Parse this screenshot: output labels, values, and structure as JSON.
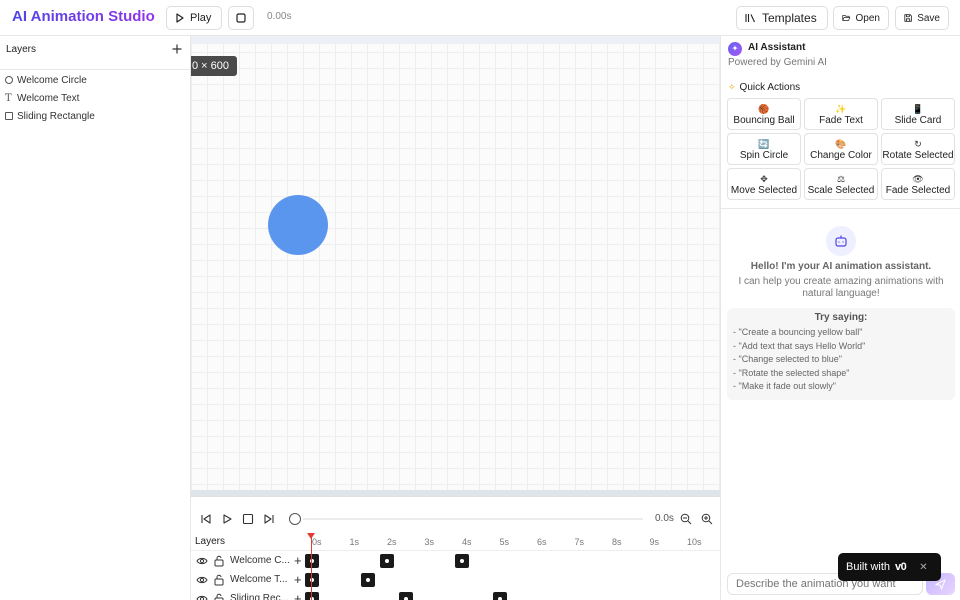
{
  "header": {
    "title": "AI Animation Studio",
    "play_label": "Play",
    "time": "0.00s",
    "templates_label": "Templates",
    "open_label": "Open",
    "save_label": "Save"
  },
  "layers_panel": {
    "title": "Layers",
    "items": [
      {
        "label": "Welcome Circle",
        "icon": "circle-icon"
      },
      {
        "label": "Welcome Text",
        "icon": "text-icon"
      },
      {
        "label": "Sliding Rectangle",
        "icon": "rectangle-icon"
      }
    ]
  },
  "canvas": {
    "size_label": "0 × 600",
    "shape_color": "#5b96ee"
  },
  "timeline": {
    "time": "0.0s",
    "layers_label": "Layers",
    "ticks": [
      "0s",
      "1s",
      "2s",
      "3s",
      "4s",
      "5s",
      "6s",
      "7s",
      "8s",
      "9s",
      "10s"
    ],
    "tracks": [
      {
        "name": "Welcome C...",
        "keyframes_s": [
          0,
          2,
          4
        ]
      },
      {
        "name": "Welcome T...",
        "keyframes_s": [
          0,
          1.5
        ]
      },
      {
        "name": "Sliding Rec...",
        "keyframes_s": [
          0,
          2.5,
          5
        ]
      }
    ]
  },
  "ai_panel": {
    "title": "AI Assistant",
    "subtitle": "Powered by Gemini AI",
    "quick_actions_title": "Quick Actions",
    "quick_actions": [
      {
        "label": "Bouncing Ball",
        "icon": "🏀"
      },
      {
        "label": "Fade Text",
        "icon": "✨"
      },
      {
        "label": "Slide Card",
        "icon": "📱"
      },
      {
        "label": "Spin Circle",
        "icon": "🔄"
      },
      {
        "label": "Change Color",
        "icon": "🎨"
      },
      {
        "label": "Rotate Selected",
        "icon": "↻"
      },
      {
        "label": "Move Selected",
        "icon": "✥"
      },
      {
        "label": "Scale Selected",
        "icon": "⚖"
      },
      {
        "label": "Fade Selected",
        "icon": "👁"
      }
    ],
    "greeting": "Hello! I'm your AI animation assistant.",
    "greeting_sub": "I can help you create amazing animations with natural language!",
    "try_title": "Try saying:",
    "suggestions": [
      "- \"Create a bouncing yellow ball\"",
      "- \"Add text that says Hello World\"",
      "- \"Change selected to blue\"",
      "- \"Rotate the selected shape\"",
      "- \"Make it fade out slowly\""
    ],
    "input_placeholder": "Describe the animation you want"
  },
  "badge": {
    "text": "Built with",
    "logo": "v0"
  }
}
